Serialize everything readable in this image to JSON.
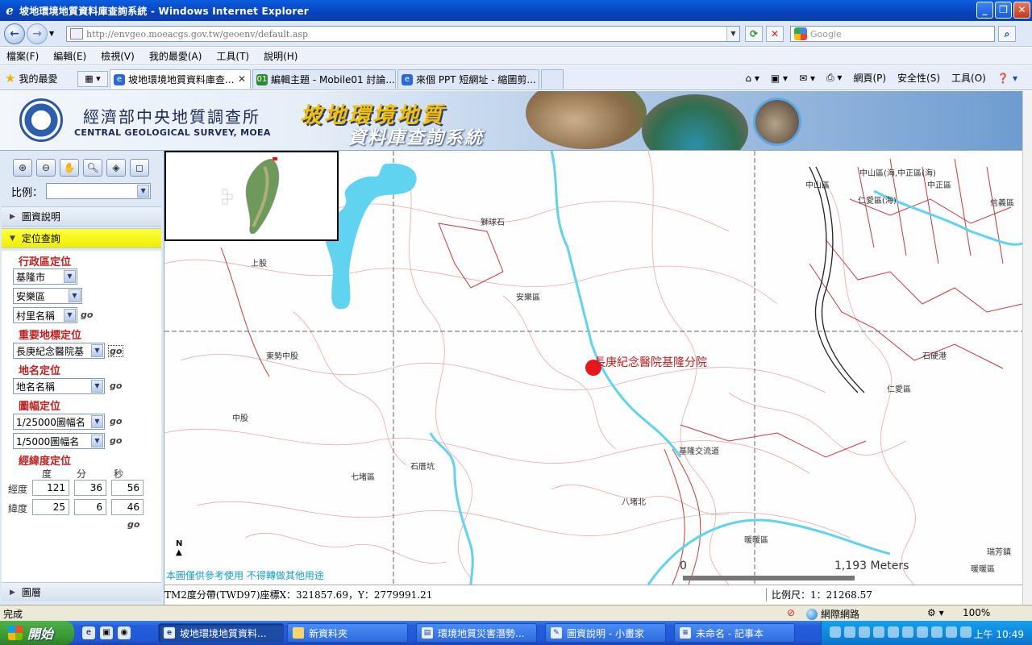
{
  "window": {
    "title": "坡地環境地質資料庫查詢系統 - Windows Internet Explorer",
    "buttons": [
      "minimize",
      "maximize",
      "close"
    ]
  },
  "address": {
    "url": "http://envgeo.moeacgs.gov.tw/geoenv/default.asp",
    "search_placeholder": "Google"
  },
  "menu": [
    "檔案(F)",
    "編輯(E)",
    "檢視(V)",
    "我的最愛(A)",
    "工具(T)",
    "說明(H)"
  ],
  "favorites_label": "我的最愛",
  "tabs": [
    {
      "label": "坡地環境地質資料庫查...",
      "active": true
    },
    {
      "label": "編輯主題 - Mobile01 討論...",
      "active": false
    },
    {
      "label": "來個 PPT 短網址 - 縮圖剪...",
      "active": false
    }
  ],
  "command_bar": [
    "網頁(P)",
    "安全性(S)",
    "工具(O)"
  ],
  "banner": {
    "org_cn": "經濟部中央地質調查所",
    "org_en": "CENTRAL GEOLOGICAL SURVEY, MOEA",
    "system_line1": "坡地環境地質",
    "system_line2": "資料庫查詢系統"
  },
  "left_panel": {
    "scale_label": "比例：",
    "scale_value": "",
    "sections": {
      "legend": "圖資說明",
      "locate": "定位查詢",
      "layers": "圖層"
    },
    "admin": {
      "title": "行政區定位",
      "city": "基隆市",
      "district": "安樂區",
      "village": "村里名稱"
    },
    "landmark": {
      "title": "重要地標定位",
      "value": "長庚紀念醫院基"
    },
    "placename": {
      "title": "地名定位",
      "value": "地名名稱"
    },
    "sheet": {
      "title": "圖幅定位",
      "sheet25000": "1/25000圖幅名",
      "sheet5000": "1/5000圖幅名"
    },
    "latlon": {
      "title": "經緯度定位",
      "headers": [
        "度",
        "分",
        "秒"
      ],
      "lon_label": "經度",
      "lat_label": "緯度",
      "lon": [
        "121",
        "36",
        "56"
      ],
      "lat": [
        "25",
        "6",
        "46"
      ]
    },
    "go_label": "go"
  },
  "map": {
    "poi_label": "長庚紀念醫院基隆分院",
    "disclaimer": "本圖僅供參考使用 不得轉做其他用途",
    "scale_zero": "0",
    "scale_distance": "1,193 Meters",
    "north": "N",
    "labels": [
      "中山區(海,中正區(海)",
      "中山區",
      "仁愛區(海)",
      "中正區",
      "信義區",
      "獅球石",
      "上股",
      "安樂區",
      "東勢中股",
      "中股",
      "七堵區",
      "石厝坑",
      "基隆交流道",
      "八堵北",
      "暖暖區",
      "仁愛區",
      "石硬港",
      "瑞芳鎮"
    ]
  },
  "coords": {
    "text": "TM2度分帶(TWD97)座標X：321857.69，Y：2779991.21",
    "scale": "比例尺：1：21268.57"
  },
  "statusbar": {
    "left": "完成",
    "zone": "網際網路",
    "zoom": "100%"
  },
  "taskbar": {
    "start": "開始",
    "items": [
      {
        "label": "坡地環境地質資料...",
        "active": true
      },
      {
        "label": "新資料夾",
        "active": false
      },
      {
        "label": "環境地質災害潛勢...",
        "active": false
      },
      {
        "label": "圖資說明 - 小畫家",
        "active": false
      },
      {
        "label": "未命名 - 記事本",
        "active": false
      }
    ],
    "clock": "上午 10:49"
  },
  "colors": {
    "poi": "#e8151b",
    "river": "#7fd2ee",
    "road": "#d55a5a",
    "highlight_section": "#ffff00"
  }
}
